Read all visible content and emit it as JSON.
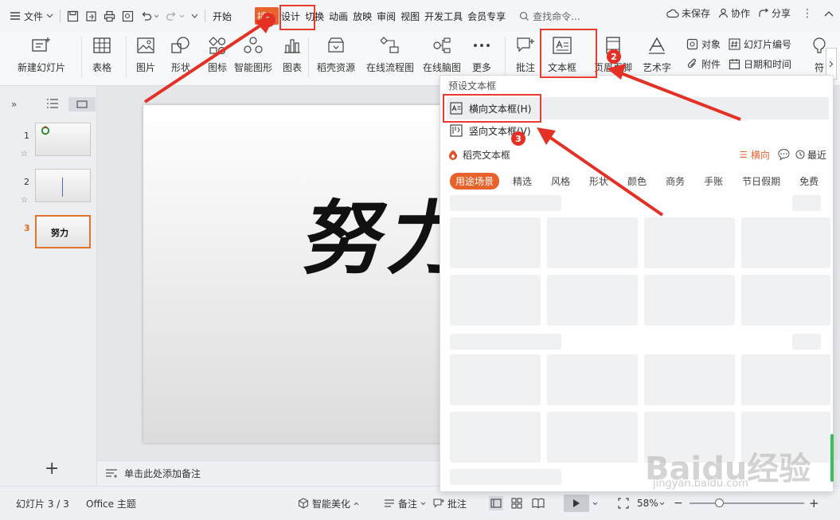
{
  "menubar": {
    "file_label": "文件",
    "tabs": [
      "开始",
      "插入",
      "设计",
      "切换",
      "动画",
      "放映",
      "审阅",
      "视图",
      "开发工具",
      "会员专享"
    ],
    "search_placeholder": "查找命令...",
    "unsaved": "未保存",
    "collab": "协作",
    "share": "分享"
  },
  "ribbon": {
    "new_slide": "新建幻灯片",
    "table": "表格",
    "image": "图片",
    "shape": "形状",
    "icon": "图标",
    "smart_graphic": "智能图形",
    "chart": "图表",
    "docer_resources": "稻壳资源",
    "online_flowchart": "在线流程图",
    "online_mindmap": "在线脑图",
    "more": "更多",
    "comment": "批注",
    "textbox": "文本框",
    "header_footer": "页眉页脚",
    "wordart": "艺术字",
    "object": "对象",
    "slide_number": "幻灯片编号",
    "attachment": "附件",
    "date_time": "日期和时间",
    "symbol_partial": "符"
  },
  "leftpanel": {
    "slides": [
      {
        "num": "1",
        "star": "☆"
      },
      {
        "num": "2",
        "star": "☆"
      },
      {
        "num": "3",
        "label": "努力"
      }
    ]
  },
  "slide": {
    "text": "努力"
  },
  "notes": {
    "placeholder": "单击此处添加备注"
  },
  "dropdown": {
    "preset_heading": "预设文本框",
    "horizontal": "横向文本框(H)",
    "vertical": "竖向文本框(V)",
    "docer_heading": "稻壳文本框",
    "orientation": "横向",
    "recent": "最近",
    "categories": [
      "用途场景",
      "精选",
      "风格",
      "形状",
      "颜色",
      "商务",
      "手账",
      "节日假期",
      "免费"
    ]
  },
  "statusbar": {
    "slide_count": "幻灯片 3 / 3",
    "theme": "Office 主题",
    "beautify": "智能美化",
    "notes": "备注",
    "comment": "批注",
    "zoom": "58%"
  },
  "annotations": [
    "1",
    "2",
    "3"
  ],
  "watermark": {
    "brand": "Baidu经验",
    "url": "jingyan.baidu.com"
  },
  "colors": {
    "accent": "#e8632b",
    "annotation": "#e53125"
  }
}
